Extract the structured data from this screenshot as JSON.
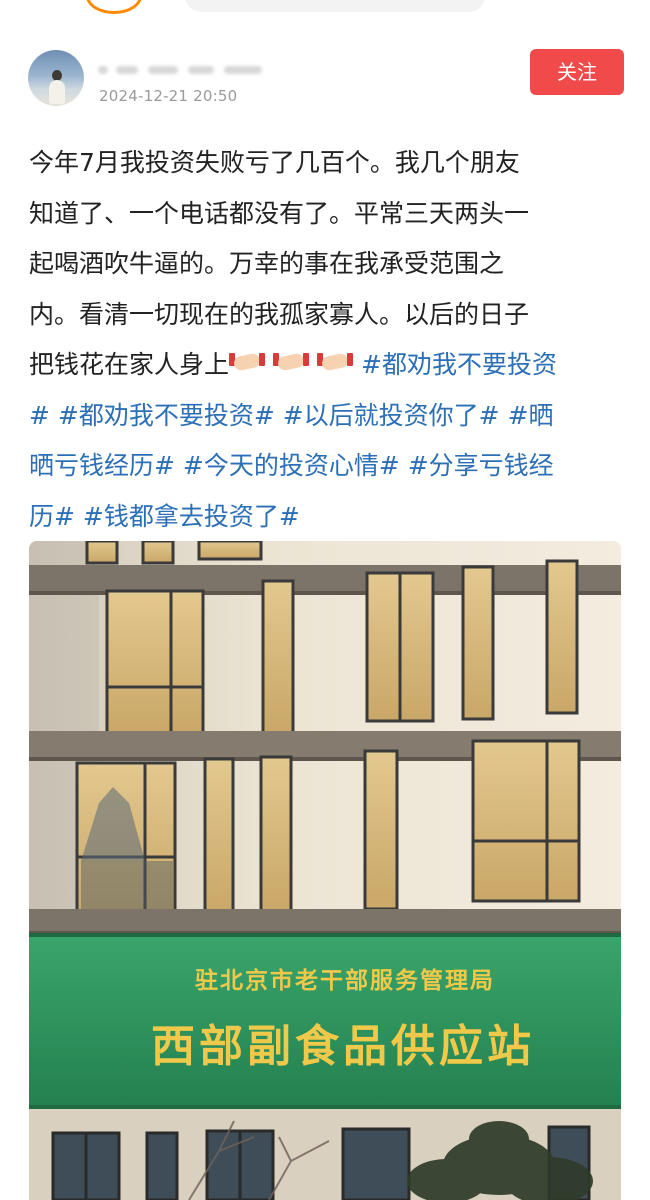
{
  "header": {
    "post_time": "2024-12-21 20:50",
    "follow_label": "关注"
  },
  "post": {
    "lines": [
      "今年7月我投资失败亏了几百个。我几个朋友",
      "知道了、一个电话都没有了。平常三天两头一",
      "起喝酒吹牛逼的。万幸的事在我承受范围之",
      "内。看清一切现在的我孤家寡人。以后的日子"
    ],
    "line5_text": "把钱花在家人身上",
    "line5_tag": "#都劝我不要投资",
    "line6": "# #都劝我不要投资# #以后就投资你了# #晒",
    "line7": "晒亏钱经历# #今天的投资心情# #分享亏钱经",
    "line8": "历# #钱都拿去投资了#"
  },
  "photo": {
    "sign_line1": "驻北京市老干部服务管理局",
    "sign_line2": "西部副食品供应站"
  },
  "colors": {
    "follow_bg": "#f04a4a",
    "hashtag": "#2c6fb6",
    "sign_bg": "#2e9660",
    "sign_text": "#f0c84a"
  }
}
